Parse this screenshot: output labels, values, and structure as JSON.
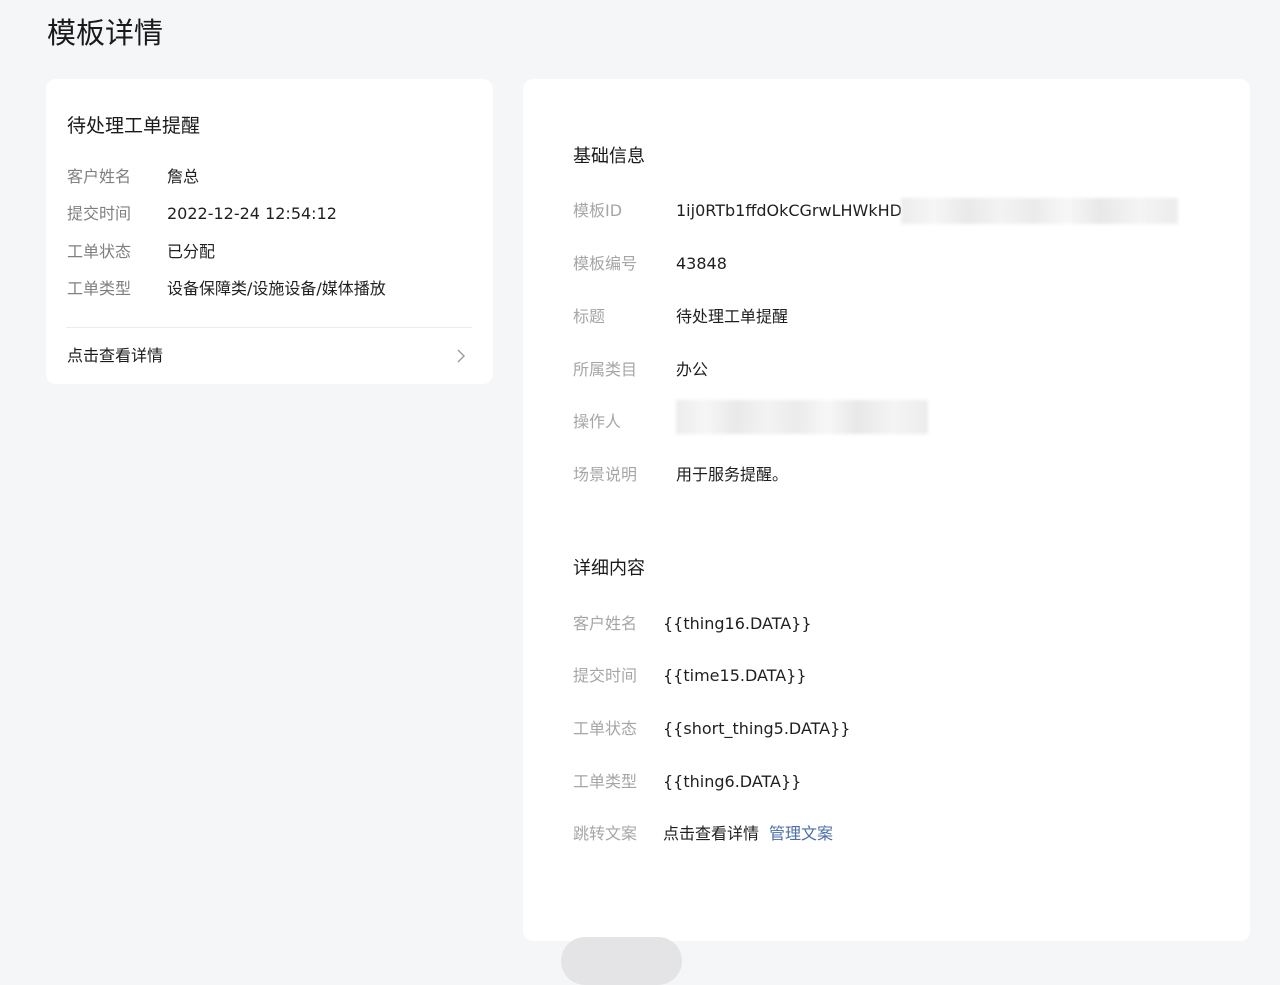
{
  "page": {
    "title": "模板详情"
  },
  "preview": {
    "title": "待处理工单提醒",
    "fields": [
      {
        "label": "客户姓名",
        "value": "詹总"
      },
      {
        "label": "提交时间",
        "value": "2022-12-24 12:54:12"
      },
      {
        "label": "工单状态",
        "value": "已分配"
      },
      {
        "label": "工单类型",
        "value": "设备保障类/设施设备/媒体播放"
      }
    ],
    "link_text": "点击查看详情",
    "link_icon": "chevron-right-icon"
  },
  "basic_info": {
    "heading": "基础信息",
    "template_id_label": "模板ID",
    "template_id_value": "1ij0RTb1ffdOkCGrwLHWkHD",
    "template_no_label": "模板编号",
    "template_no_value": "43848",
    "title_label": "标题",
    "title_value": "待处理工单提醒",
    "category_label": "所属类目",
    "category_value": "办公",
    "operator_label": "操作人",
    "scene_label": "场景说明",
    "scene_value": "用于服务提醒。"
  },
  "detail_content": {
    "heading": "详细内容",
    "fields": [
      {
        "label": "客户姓名",
        "value": "{{thing16.DATA}}"
      },
      {
        "label": "提交时间",
        "value": "{{time15.DATA}}"
      },
      {
        "label": "工单状态",
        "value": "{{short_thing5.DATA}}"
      },
      {
        "label": "工单类型",
        "value": "{{thing6.DATA}}"
      }
    ],
    "jump_label": "跳转文案",
    "jump_value": "点击查看详情",
    "manage_link": "管理文案"
  },
  "colors": {
    "background": "#f5f6f8",
    "card": "#ffffff",
    "label": "#a6a6a6",
    "link": "#4a6ea8"
  }
}
